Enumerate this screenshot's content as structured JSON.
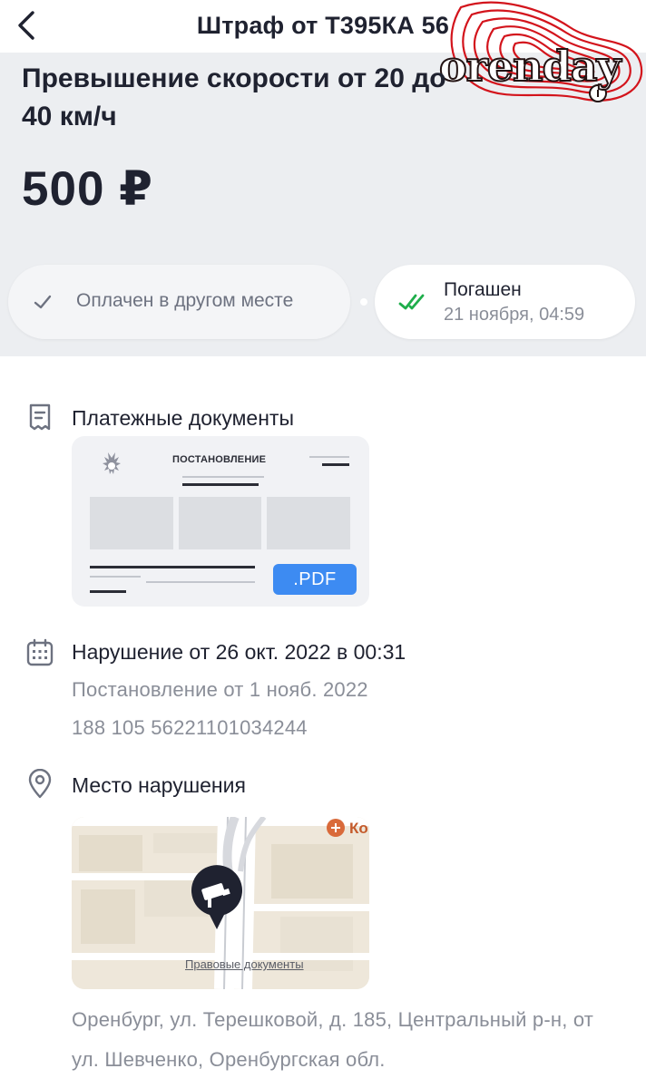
{
  "nav": {
    "title": "Штраф от Т395КА 56",
    "back_icon": "chevron-left-icon"
  },
  "watermark": {
    "logo_text": "orenday",
    "color": "#d3141c"
  },
  "fine": {
    "title": "Превышение скорости от 20 до 40 км/ч",
    "amount": "500 ₽"
  },
  "status": {
    "step1_label": "Оплачен в другом месте",
    "step2_label": "Погашен",
    "step2_time": "21 ноября, 04:59",
    "accent": "#1fae4b"
  },
  "documents": {
    "title": "Платежные документы",
    "preview_heading": "ПОСТАНОВЛЕНИЕ",
    "pdf_label": ".PDF",
    "pdf_color": "#3d8bf2"
  },
  "violation": {
    "title": "Нарушение от 26 окт. 2022 в 00:31",
    "resolution": "Постановление от 1 нояб. 2022",
    "number": "188 105 56221101034244"
  },
  "location": {
    "title": "Место нарушения",
    "map_legal_link": "Правовые документы",
    "map_poi": "Ко",
    "address": "Оренбург, ул. Терешковой, д. 185, Центральный р-н, от ул. Шевченко, Оренбургская обл."
  }
}
